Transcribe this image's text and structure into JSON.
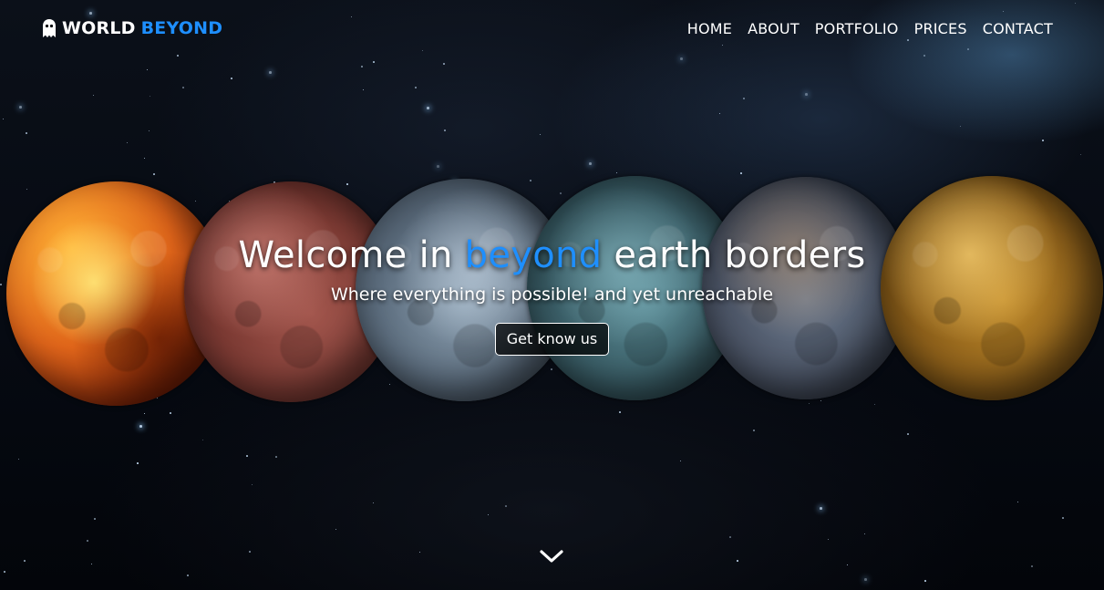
{
  "header": {
    "brand": {
      "word1": "WORLD",
      "word2": "BEYOND",
      "icon": "ghost-icon",
      "accent_color": "#1e8fff"
    },
    "nav": [
      "HOME",
      "ABOUT",
      "PORTFOLIO",
      "PRICES",
      "CONTACT"
    ]
  },
  "hero": {
    "title_part1": "Welcome in ",
    "title_highlight": "beyond",
    "title_part2": " earth borders",
    "subtitle": "Where everything is possible! and yet unreachable",
    "cta_label": "Get know us",
    "scroll_icon": "chevron-down-icon"
  },
  "colors": {
    "accent": "#1e8fff",
    "text": "#ffffff",
    "background": "#05070c"
  }
}
